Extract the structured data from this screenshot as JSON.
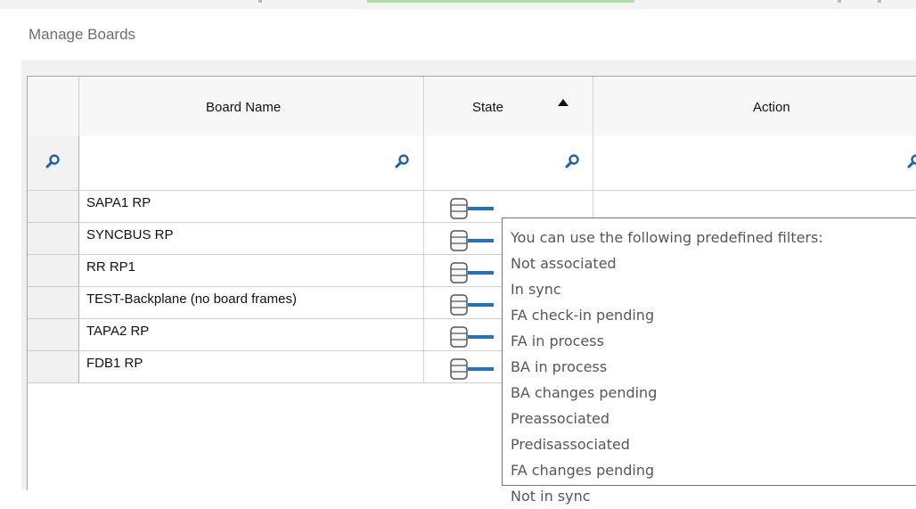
{
  "window": {
    "title": "Manage Boards"
  },
  "grid": {
    "columns": [
      {
        "label": "Board Name"
      },
      {
        "label": "State",
        "sort": "ascending"
      },
      {
        "label": "Action"
      }
    ],
    "rows": [
      {
        "board_name": "SAPA1 RP"
      },
      {
        "board_name": "SYNCBUS RP"
      },
      {
        "board_name": "RR RP1"
      },
      {
        "board_name": "TEST-Backplane (no board frames)"
      },
      {
        "board_name": "TAPA2 RP"
      },
      {
        "board_name": "FDB1 RP"
      }
    ]
  },
  "tooltip": {
    "heading": "You can use the following predefined filters:",
    "filters": [
      "Not associated",
      "In sync",
      "FA check-in pending",
      "FA in process",
      "BA in process",
      "BA changes pending",
      "Preassociated",
      "Predisassociated",
      "FA changes pending",
      "Not in sync"
    ]
  },
  "icons": {
    "filter": "magnifier-icon",
    "state": "database-link-icon",
    "sort": "sort-ascending-arrow-icon"
  },
  "colors": {
    "accent": "#1e73c8",
    "magnifier": "#1e5fb0"
  }
}
